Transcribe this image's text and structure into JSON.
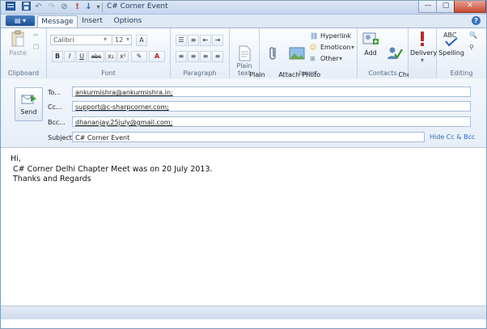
{
  "window": {
    "title": "C# Corner Event",
    "controls": [
      "—",
      "▢",
      "✕"
    ]
  },
  "quick_access": [
    "save-icon",
    "undo-icon",
    "redo-icon",
    "attach-icon",
    "high-priority-icon",
    "low-priority-icon",
    "customize-icon"
  ],
  "ribbon": {
    "app_menu_label": "▤ ▾",
    "tabs": [
      "Message",
      "Insert",
      "Options"
    ],
    "active_tab": "Message",
    "help": "?",
    "clipboard": {
      "paste": "Paste",
      "group": "Clipboard"
    },
    "font": {
      "family": "Calibri",
      "size": "12",
      "group": "Font",
      "bold": "B",
      "italic": "I",
      "underline": "U",
      "strike": "abc",
      "sub": "x₂",
      "sup": "x²",
      "highlight": "✎",
      "color": "A"
    },
    "paragraph": {
      "group": "Paragraph"
    },
    "plain_text": {
      "label": "Plain\ntext",
      "group": "Plain text"
    },
    "insert": {
      "attach": "Attach\nfile",
      "photo": "Photo\nalbum",
      "hyperlink": "Hyperlink",
      "emoticon": "Emoticon",
      "other": "Other",
      "group": "Insert"
    },
    "contacts": {
      "add": "Add",
      "check": "Check\nnames",
      "group": "Contacts"
    },
    "delivery": {
      "label": "Delivery"
    },
    "editing": {
      "spelling": "Spelling",
      "group": "Editing"
    }
  },
  "compose": {
    "send_label": "Send",
    "to_label": "To...",
    "cc_label": "Cc...",
    "bcc_label": "Bcc...",
    "subject_label": "Subject",
    "to_value": "ankurmishra@ankurmishra.in;",
    "cc_value": "support@c-sharpcorner.com;",
    "bcc_value": "dhananjay.25july@gmail.com;",
    "subject_value": "C# Corner Event",
    "hide_cc_bcc": "Hide Cc & Bcc"
  },
  "body": {
    "line1": "Hi,",
    "line2": "C# Corner Delhi Chapter Meet was on 20 July 2013.",
    "line3": "Thanks and Regards"
  },
  "colors": {
    "accent": "#2a6fc0",
    "ribbon": "#e5edf7",
    "frame": "#7f9db9"
  }
}
